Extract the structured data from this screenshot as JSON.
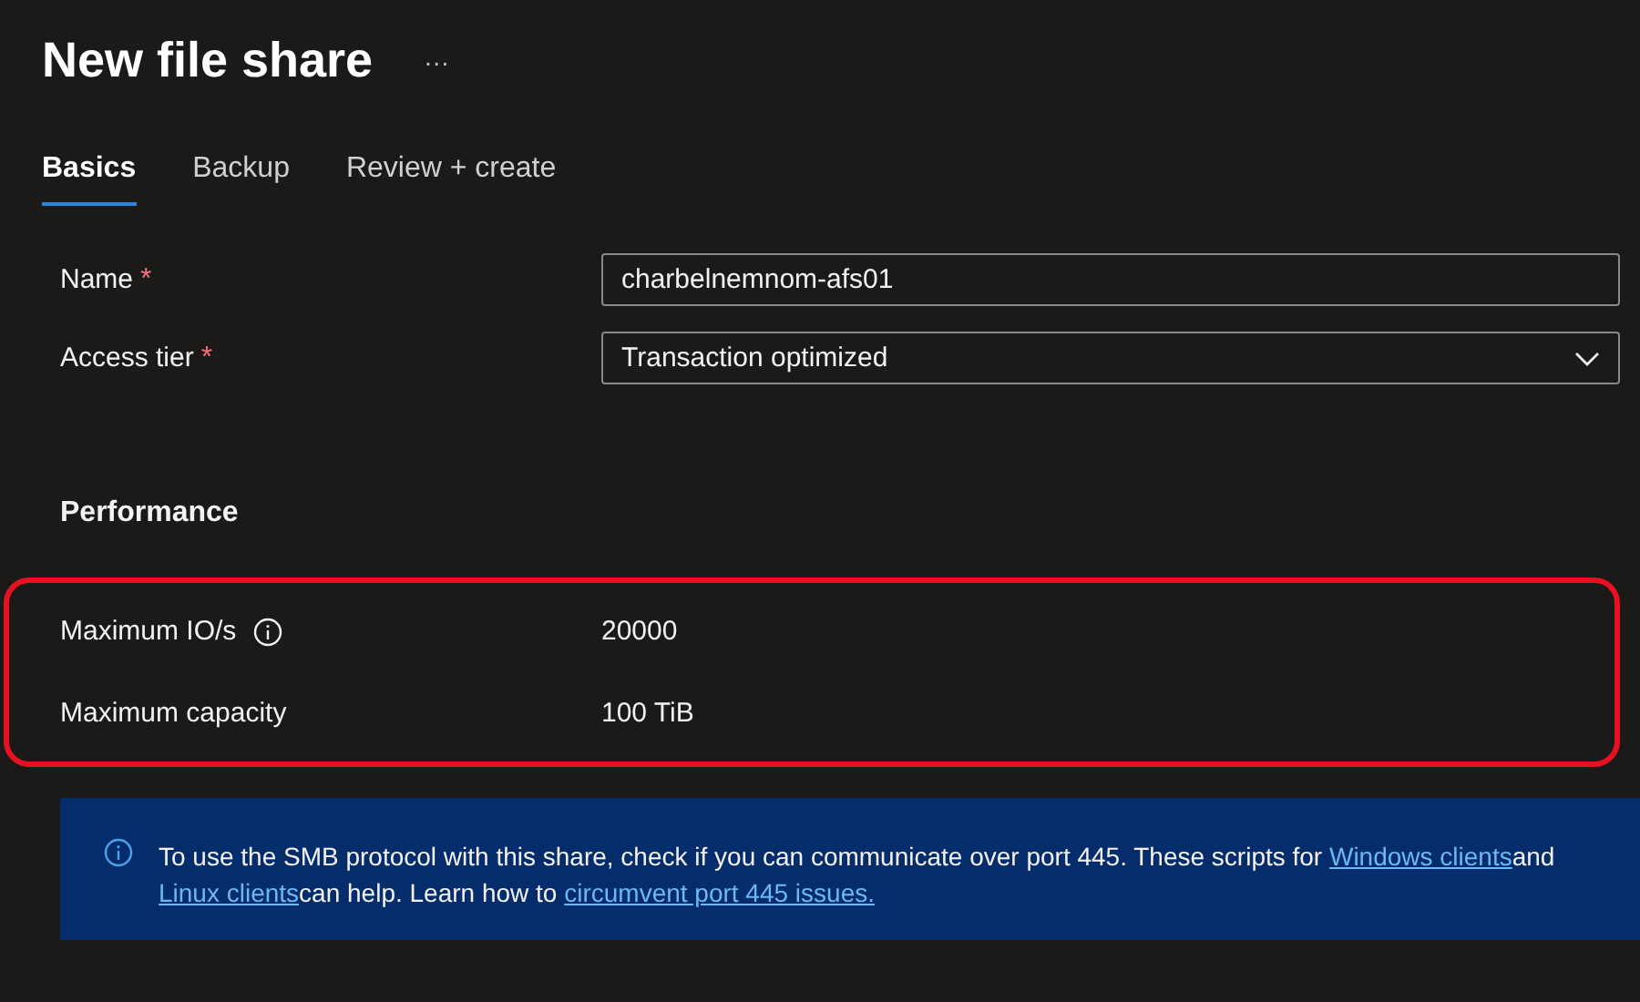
{
  "header": {
    "title": "New file share",
    "more": "···"
  },
  "tabs": [
    {
      "label": "Basics",
      "selected": true
    },
    {
      "label": "Backup",
      "selected": false
    },
    {
      "label": "Review + create",
      "selected": false
    }
  ],
  "fields": [
    {
      "kind": "text",
      "label": "Name",
      "required_mark": "*",
      "value": "charbelnemnom-afs01"
    },
    {
      "kind": "dropdown",
      "label": "Access tier",
      "required_mark": "*",
      "value": "Transaction optimized"
    }
  ],
  "performance": {
    "heading": "Performance",
    "highlighted": true,
    "rows": [
      {
        "label": "Maximum IO/s",
        "info": true,
        "value": "20000"
      },
      {
        "label": "Maximum capacity",
        "info": false,
        "value": "100 TiB"
      }
    ]
  },
  "banner": {
    "parts": [
      {
        "kind": "text",
        "text": "To use the SMB protocol with this share, check if you can communicate over port 445. These scripts for "
      },
      {
        "kind": "link",
        "text": "Windows clients"
      },
      {
        "kind": "text",
        "text": "and "
      },
      {
        "kind": "link",
        "text": "Linux clients"
      },
      {
        "kind": "text",
        "text": "can help. Learn how to "
      },
      {
        "kind": "link",
        "text": "circumvent port 445 issues."
      }
    ]
  }
}
